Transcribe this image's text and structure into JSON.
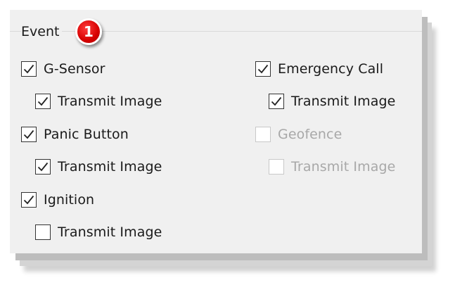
{
  "group": {
    "title": "Event",
    "badge": "1"
  },
  "left_column": [
    {
      "label": "G-Sensor",
      "checked": true,
      "enabled": true,
      "sub": {
        "label": "Transmit Image",
        "checked": true,
        "enabled": true
      }
    },
    {
      "label": "Panic Button",
      "checked": true,
      "enabled": true,
      "sub": {
        "label": "Transmit Image",
        "checked": true,
        "enabled": true
      }
    },
    {
      "label": "Ignition",
      "checked": true,
      "enabled": true,
      "sub": {
        "label": "Transmit Image",
        "checked": false,
        "enabled": true
      }
    }
  ],
  "right_column": [
    {
      "label": "Emergency Call",
      "checked": true,
      "enabled": true,
      "sub": {
        "label": "Transmit Image",
        "checked": true,
        "enabled": true
      }
    },
    {
      "label": "Geofence",
      "checked": false,
      "enabled": false,
      "sub": {
        "label": "Transmit Image",
        "checked": false,
        "enabled": false
      }
    }
  ],
  "colors": {
    "badge": "#d60000",
    "disabled_text": "#a8a8a8",
    "panel_bg": "#f0f0f0"
  }
}
